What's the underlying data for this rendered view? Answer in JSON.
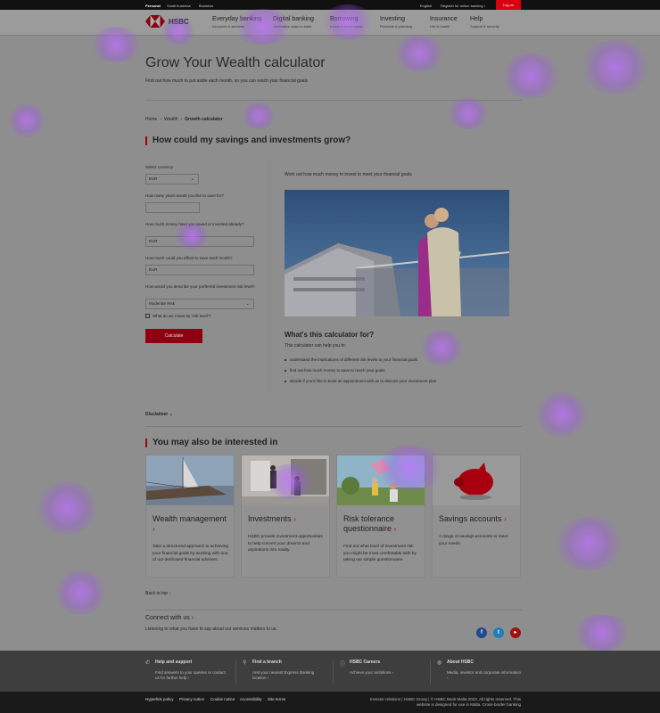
{
  "topbar": {
    "segments": [
      "Personal",
      "Small business",
      "Business"
    ],
    "language": "English",
    "register": "Register for online banking",
    "login": "Log on"
  },
  "brand": {
    "name": "HSBC",
    "red": "#db0011"
  },
  "nav": [
    {
      "title": "Everyday banking",
      "sub": "Accounts & services"
    },
    {
      "title": "Digital banking",
      "sub": "Alternative ways to bank"
    },
    {
      "title": "Borrowing",
      "sub": "Loans & home loans"
    },
    {
      "title": "Investing",
      "sub": "Products & planning"
    },
    {
      "title": "Insurance",
      "sub": "Life & health"
    },
    {
      "title": "Help",
      "sub": "Support & security"
    }
  ],
  "page": {
    "title": "Grow Your Wealth calculator",
    "subtitle": "Find out how much to put aside each month, so you can reach your financial goals"
  },
  "breadcrumb": [
    "Home",
    "Wealth",
    "Growth calculator"
  ],
  "calculator": {
    "heading": "How could my savings and investments grow?",
    "currency_label": "Select currency",
    "currency_value": "EUR",
    "years_label": "How many years would you like to save for?",
    "years_value": "",
    "saved_label": "How much money have you saved or invested already?",
    "saved_value": "EUR",
    "monthly_label": "How much could you afford to save each month?",
    "monthly_value": "EUR",
    "risk_label": "How would you describe your preferred investment risk level?",
    "risk_value": "Moderate Risk",
    "risk_help": "What do we mean by 'risk level'?",
    "calculate": "Calculate"
  },
  "info": {
    "intro": "Work out how much money to invest to meet your financial goals",
    "what_heading": "What's this calculator for?",
    "what_intro": "This calculator can help you to:",
    "bullets": [
      "understand the implications of different risk levels to your financial goals",
      "find out how much money to save to reach your goals",
      "decide if you'd like to book an appointment with us to discuss your investment plan"
    ]
  },
  "disclaimer": "Disclaimer",
  "interested": {
    "heading": "You may also be interested in",
    "cards": [
      {
        "title": "Wealth management",
        "desc": "Take a structured approach to achieving your financial goals by working with one of our dedicated financial advisers."
      },
      {
        "title": "Investments",
        "desc": "HSBC provide investment opportunities to help convert your dreams and aspirations into reality."
      },
      {
        "title": "Risk tolerance questionnaire",
        "desc": "Find out what level of investment risk you might be most comfortable with by taking our simple questionnaire."
      },
      {
        "title": "Savings accounts",
        "desc": "A range of savings accounts to meet your needs."
      }
    ]
  },
  "back_to_top": "Back to top",
  "connect": {
    "heading": "Connect with us",
    "text": "Listening to what you have to say about our services matters to us.",
    "social_icons": [
      "facebook-icon",
      "twitter-icon",
      "youtube-icon"
    ]
  },
  "footer": {
    "cols": [
      {
        "title": "Help and support",
        "text": "Find answers to your queries or contact us for further help"
      },
      {
        "title": "Find a branch",
        "text": "And your nearest Express Banking location"
      },
      {
        "title": "HSBC Careers",
        "text": "Achieve your ambitions"
      },
      {
        "title": "About HSBC",
        "text": "Media, investor and corporate information"
      }
    ],
    "links": [
      "Hyperlink policy",
      "Privacy notice",
      "Cookie notice",
      "Accessibility",
      "Site terms"
    ],
    "legal": "Investor relations | HSBC Group | © HSBC Bank Malta 2023. All rights reserved. This website is designed for use in Malta. Cross-border banking"
  }
}
